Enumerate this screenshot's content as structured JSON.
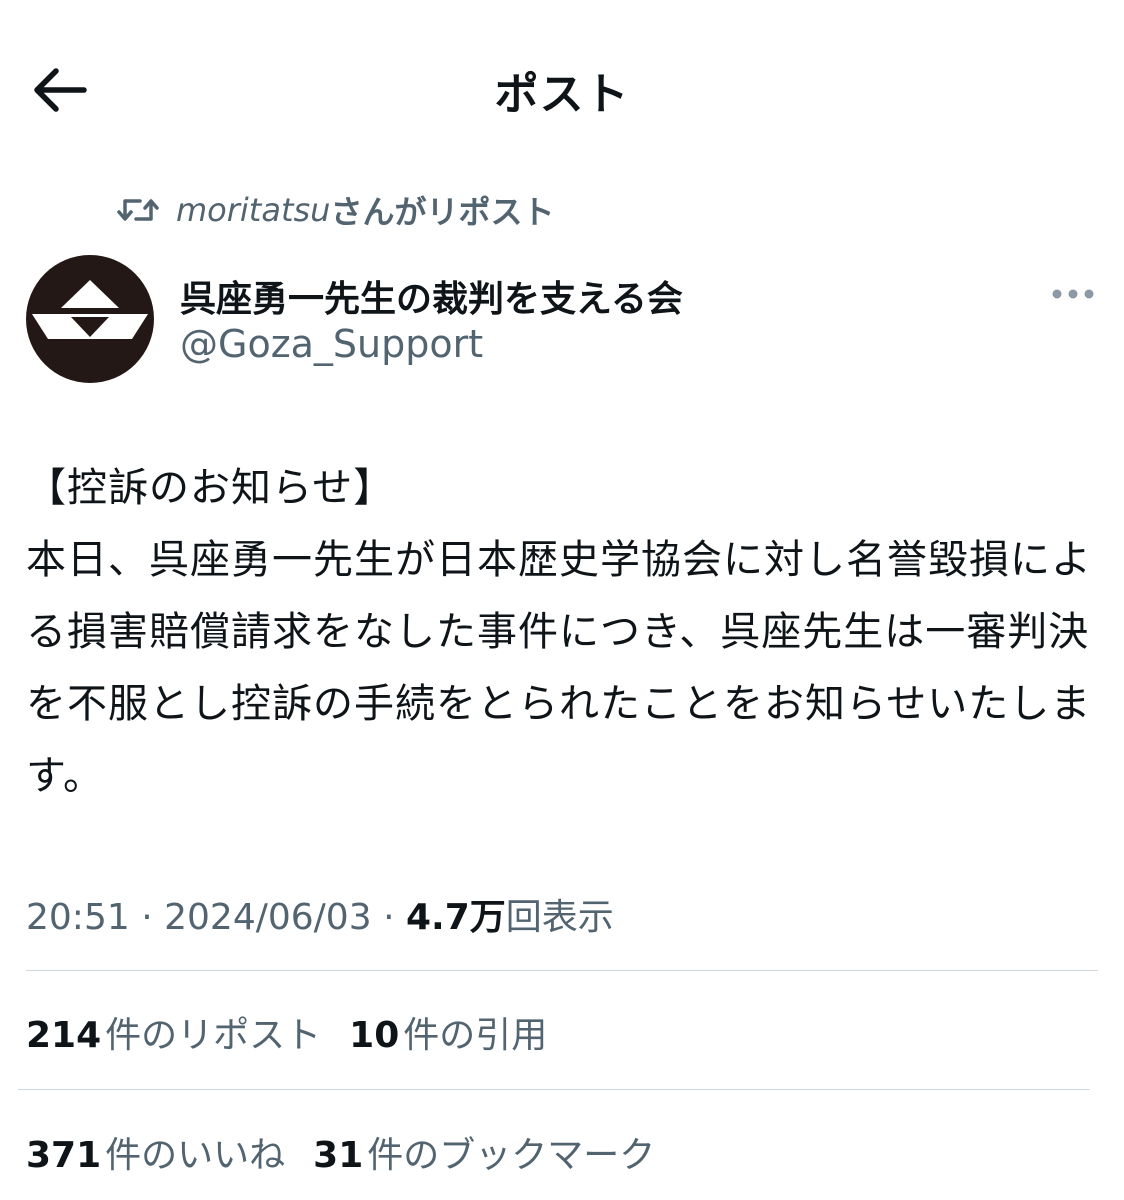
{
  "header": {
    "title": "ポスト",
    "back_icon": "arrow-left-icon"
  },
  "repost": {
    "user": "moritatsu",
    "suffix": "さんがリポスト",
    "icon": "repost-icon"
  },
  "author": {
    "display_name": "呉座勇一先生の裁判を支える会",
    "handle": "@Goza_Support",
    "avatar_icon": "triangle-logo-avatar"
  },
  "post": {
    "text": "【控訴のお知らせ】\n本日、呉座勇一先生が日本歴史学協会に対し名誉毀損による損害賠償請求をなした事件につき、呉座先生は一審判決を不服とし控訴の手続をとられたことをお知らせいたします。",
    "time": "20:51",
    "date": "2024/06/03",
    "views_count": "4.7万",
    "views_label": "回表示",
    "separator": "·"
  },
  "stats": {
    "reposts": {
      "count": "214",
      "label": "件のリポスト"
    },
    "quotes": {
      "count": "10",
      "label": "件の引用"
    },
    "likes": {
      "count": "371",
      "label": "件のいいね"
    },
    "bookmarks": {
      "count": "31",
      "label": "件のブックマーク"
    }
  },
  "colors": {
    "text": "#0f1419",
    "secondary": "#536471",
    "divider": "#cfd9de",
    "avatar_bg": "#231815"
  }
}
